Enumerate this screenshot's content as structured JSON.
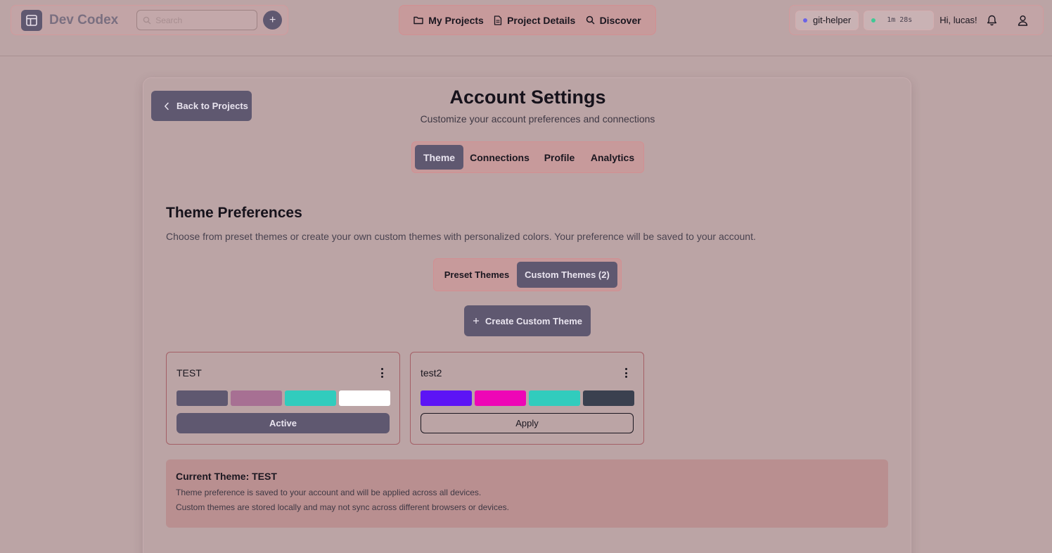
{
  "header": {
    "brand": "Dev Codex",
    "search_placeholder": "Search",
    "add_label": "+",
    "nav": [
      {
        "label": "My Projects",
        "icon": "folder-icon"
      },
      {
        "label": "Project Details",
        "icon": "document-icon"
      },
      {
        "label": "Discover",
        "icon": "search-icon"
      }
    ],
    "project_chip": "git-helper",
    "timer": "1m 28s",
    "greeting": "Hi, lucas!"
  },
  "page": {
    "back_label": "Back to Projects",
    "title": "Account Settings",
    "subtitle": "Customize your account preferences and connections",
    "tabs": [
      "Theme",
      "Connections",
      "Profile",
      "Analytics"
    ],
    "active_tab": "Theme"
  },
  "theme": {
    "heading": "Theme Preferences",
    "description": "Choose from preset themes or create your own custom themes with personalized colors. Your preference will be saved to your account.",
    "subtabs": [
      "Preset Themes",
      "Custom Themes (2)"
    ],
    "create_label": "Create Custom Theme",
    "cards": [
      {
        "name": "TEST",
        "colors": [
          "#5f5870",
          "#a77093",
          "#31ccbd",
          "#ffffff"
        ],
        "button": "Active"
      },
      {
        "name": "test2",
        "colors": [
          "#5c14f5",
          "#ee06b6",
          "#31ccbd",
          "#3a404f"
        ],
        "button": "Apply"
      }
    ],
    "info": {
      "title": "Current Theme: TEST",
      "line1": "Theme preference is saved to your account and will be applied across all devices.",
      "line2": "Custom themes are stored locally and may not sync across different browsers or devices."
    }
  },
  "colors": {
    "accent": "#5f5870",
    "background": "#bba4a5",
    "highlight": "#c79a9b"
  }
}
